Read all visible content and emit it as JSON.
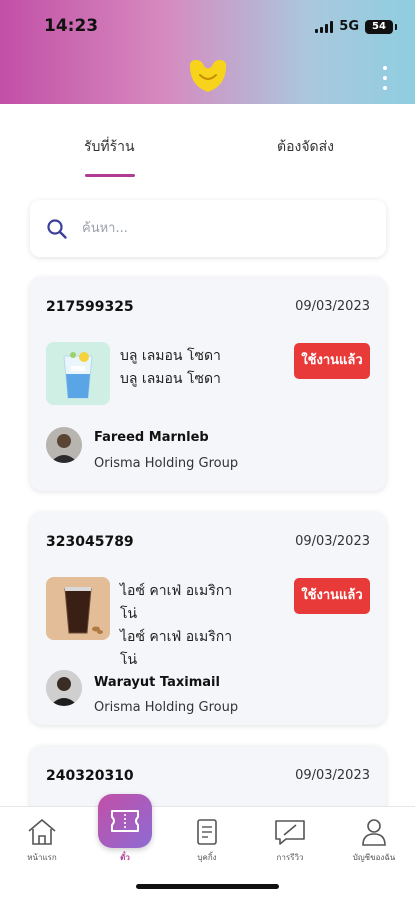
{
  "status_bar": {
    "time": "14:23",
    "network": "5G",
    "battery": "54"
  },
  "tabs": [
    {
      "label": "รับที่ร้าน",
      "active": true
    },
    {
      "label": "ต้องจัดส่ง",
      "active": false
    }
  ],
  "search": {
    "placeholder": "ค้นหา...",
    "value": ""
  },
  "orders": [
    {
      "id": "217599325",
      "date": "09/03/2023",
      "item_lines": [
        "บลู เลมอน โซดา",
        "บลู เลมอน โซดา"
      ],
      "status": "ใช้งานแล้ว",
      "person": "Fareed Marnleb",
      "company": "Orisma Holding Group",
      "thumb_icon": "blue-lemon-soda-icon"
    },
    {
      "id": "323045789",
      "date": "09/03/2023",
      "item_lines": [
        "ไอซ์ คาเฟ่ อเมริกา",
        "โน่",
        "ไอซ์ คาเฟ่ อเมริกา",
        "โน่"
      ],
      "status": "ใช้งานแล้ว",
      "person": "Warayut Taximail",
      "company": "Orisma Holding Group",
      "thumb_icon": "iced-americano-icon"
    },
    {
      "id": "240320310",
      "date": "09/03/2023"
    }
  ],
  "bottom_nav": [
    {
      "label": "หน้าแรก",
      "icon": "home-icon"
    },
    {
      "label": "ตั๋ว",
      "icon": "ticket-icon",
      "active": true
    },
    {
      "label": "บุคกิ้ง",
      "icon": "bookmark-list-icon"
    },
    {
      "label": "การรีวิว",
      "icon": "review-icon"
    },
    {
      "label": "บัญชีของฉัน",
      "icon": "account-icon"
    }
  ],
  "colors": {
    "accent": "#b03c95",
    "status_badge": "#e93a3a",
    "card_bg": "#f5f6fa"
  }
}
